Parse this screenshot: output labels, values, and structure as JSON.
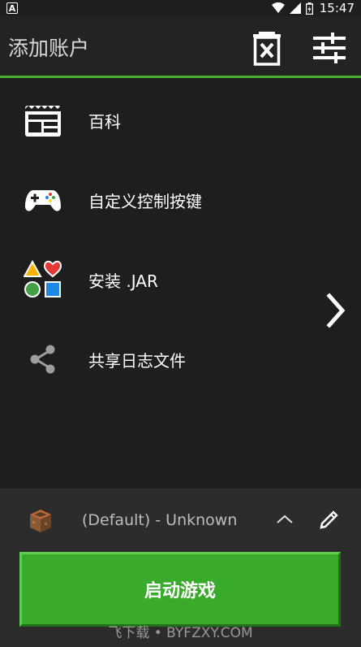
{
  "status_bar": {
    "time": "15:47",
    "notification_glyph": "A"
  },
  "app_bar": {
    "title": "添加账户",
    "icons": [
      "delete-account-icon",
      "settings-sliders-icon"
    ]
  },
  "menu": {
    "items": [
      {
        "label": "百科",
        "icon": "wiki-news-icon"
      },
      {
        "label": "自定义控制按键",
        "icon": "gamepad-icon"
      },
      {
        "label": "安装 .JAR",
        "icon": "shapes-install-icon"
      },
      {
        "label": "共享日志文件",
        "icon": "share-icon"
      }
    ]
  },
  "profile": {
    "name": "(Default) - Unknown"
  },
  "launch_button": {
    "label": "启动游戏"
  },
  "watermark": "飞下载 • BYFZXY.COM",
  "colors": {
    "accent": "#4caf2f",
    "launch": "#3aaa2c",
    "background": "#1e1e1e",
    "panel": "#2c2c2c"
  }
}
